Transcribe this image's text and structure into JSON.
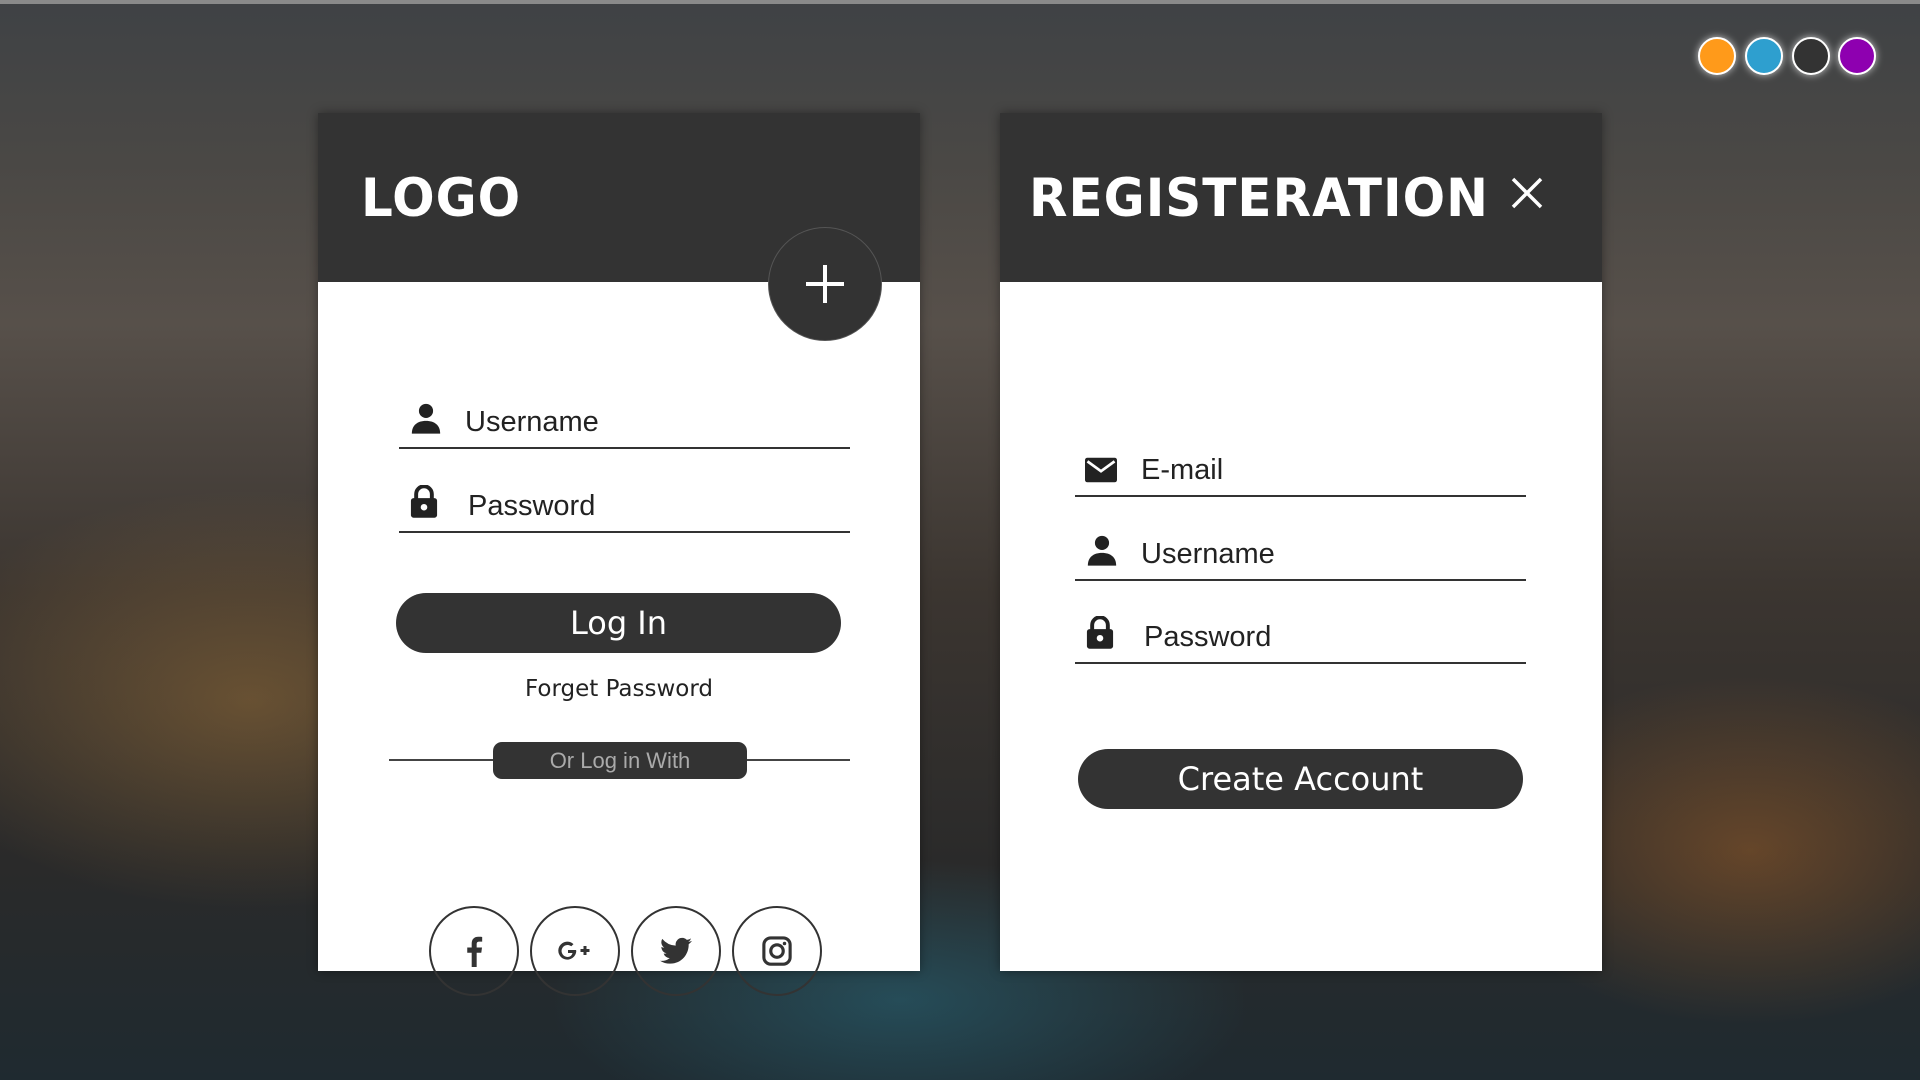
{
  "theme_dots": [
    {
      "name": "orange",
      "color": "#FF9A1A"
    },
    {
      "name": "blue",
      "color": "#2E9FCF"
    },
    {
      "name": "dark",
      "color": "#333333"
    },
    {
      "name": "purple",
      "color": "#8E00B0"
    }
  ],
  "login": {
    "logo": "LOGO",
    "add_icon": "plus-icon",
    "username_placeholder": "Username",
    "password_placeholder": "Password",
    "login_button": "Log In",
    "forget_password": "Forget Password",
    "or_login_with": "Or Log in With",
    "social": [
      "facebook-icon",
      "google-plus-icon",
      "twitter-icon",
      "instagram-icon"
    ]
  },
  "register": {
    "title": "REGISTERATION",
    "close_icon": "close-icon",
    "email_placeholder": "E-mail",
    "username_placeholder": "Username",
    "password_placeholder": "Password",
    "create_button": "Create Account"
  }
}
